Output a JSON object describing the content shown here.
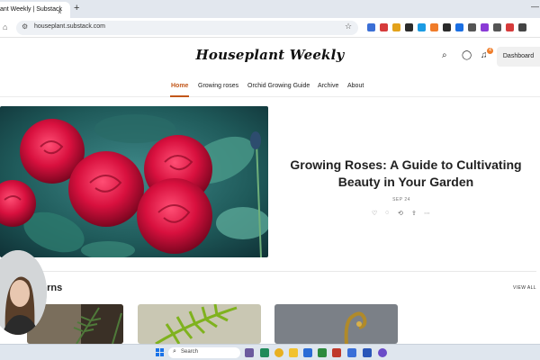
{
  "browser": {
    "tab_title": "ant Weekly | Substack",
    "tab_close": "×",
    "new_tab": "+",
    "minimize": "—",
    "url": "houseplant.substack.com",
    "ext_colors": [
      "#3b6fd6",
      "#d63b3b",
      "#e3a21b",
      "#2b2b2b",
      "#1b9be3",
      "#f07c2a",
      "#2b2b2b",
      "#1b6fe3",
      "#555",
      "#8a3bd6",
      "#555",
      "#d63b3b",
      "#444"
    ]
  },
  "header": {
    "pub_title": "Houseplant Weekly",
    "bell_badge": "4",
    "dashboard_label": "Dashboard"
  },
  "nav": {
    "items": [
      "Home",
      "Growing roses",
      "Orchid Growing Guide",
      "Archive",
      "About"
    ],
    "active": "Home",
    "accent_color": "#c2571a"
  },
  "hero": {
    "title": "Growing Roses: A Guide to Cultivating Beauty in Your Garden",
    "date": "SEP 24",
    "actions": [
      "like-icon",
      "comment-icon",
      "restack-icon",
      "share-icon",
      "more-icon"
    ]
  },
  "section": {
    "title": "erns",
    "view_all": "VIEW ALL"
  },
  "taskbar": {
    "search_label": "Search"
  }
}
